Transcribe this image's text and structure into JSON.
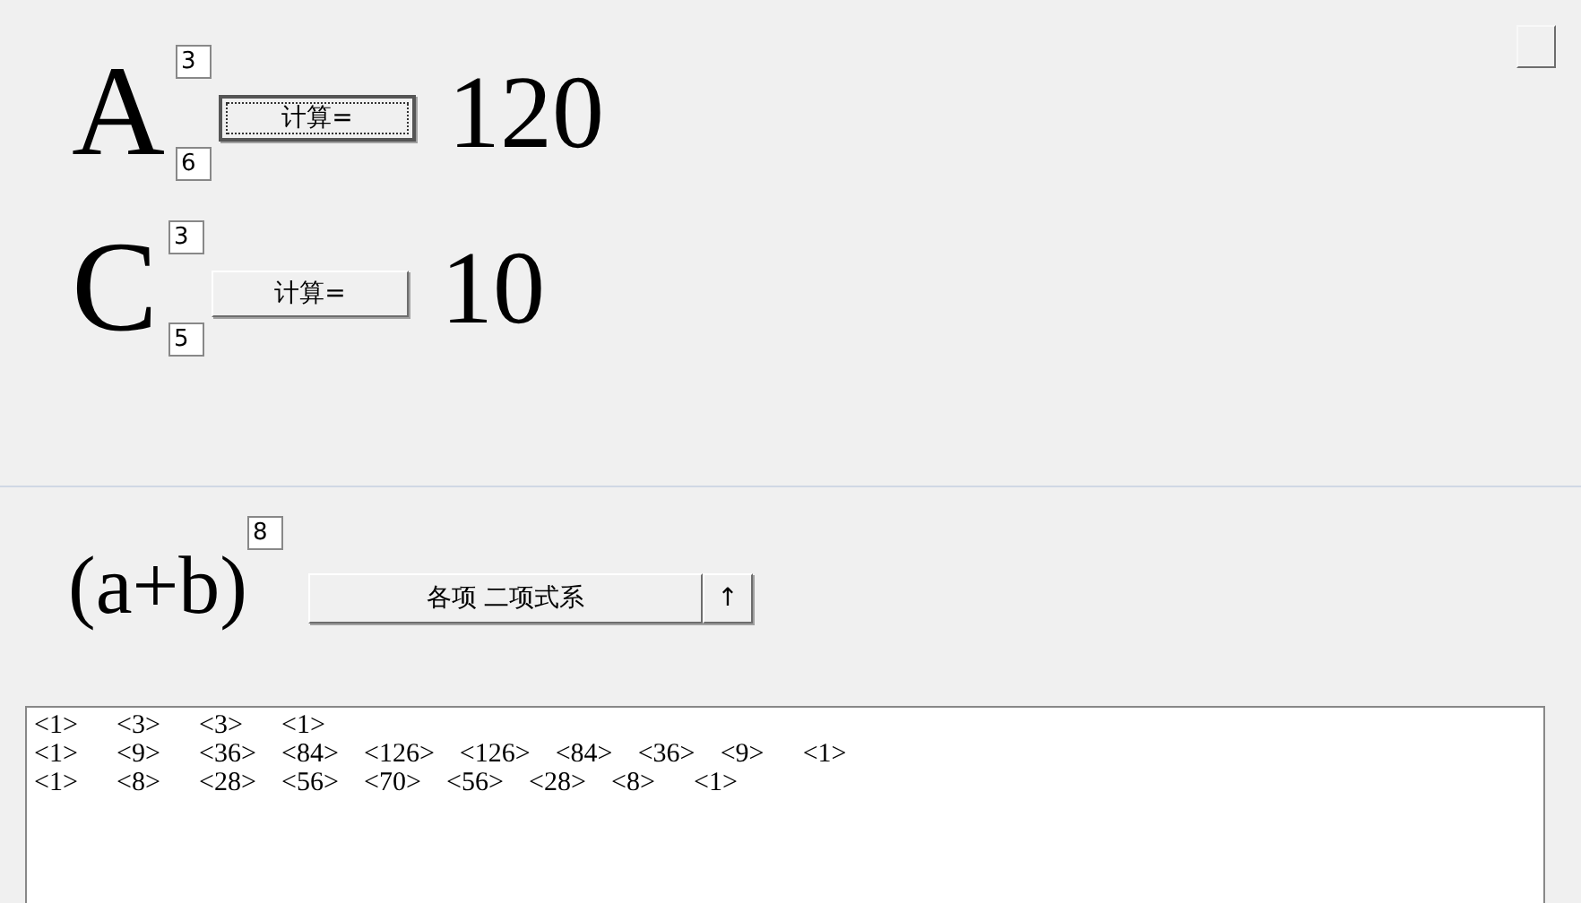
{
  "calculators": [
    {
      "symbol": "A",
      "upper": "3",
      "lower": "6",
      "button": "计算=",
      "focused": true,
      "result": "120"
    },
    {
      "symbol": "C",
      "upper": "3",
      "lower": "5",
      "button": "计算=",
      "focused": false,
      "result": "10"
    }
  ],
  "binomial": {
    "expression": "(a+b)",
    "exponent": "8",
    "button": "各项 二项式系",
    "arrow_button": "↑"
  },
  "output_lines": [
    [
      "<1>",
      "<3>",
      "<3>",
      "<1>"
    ],
    [
      "<1>",
      "<9>",
      "<36>",
      "<84>",
      "<126>",
      "<126>",
      "<84>",
      "<36>",
      "<9>",
      "<1>"
    ],
    [
      "<1>",
      "<8>",
      "<28>",
      "<56>",
      "<70>",
      "<56>",
      "<28>",
      "<8>",
      "<1>"
    ]
  ]
}
